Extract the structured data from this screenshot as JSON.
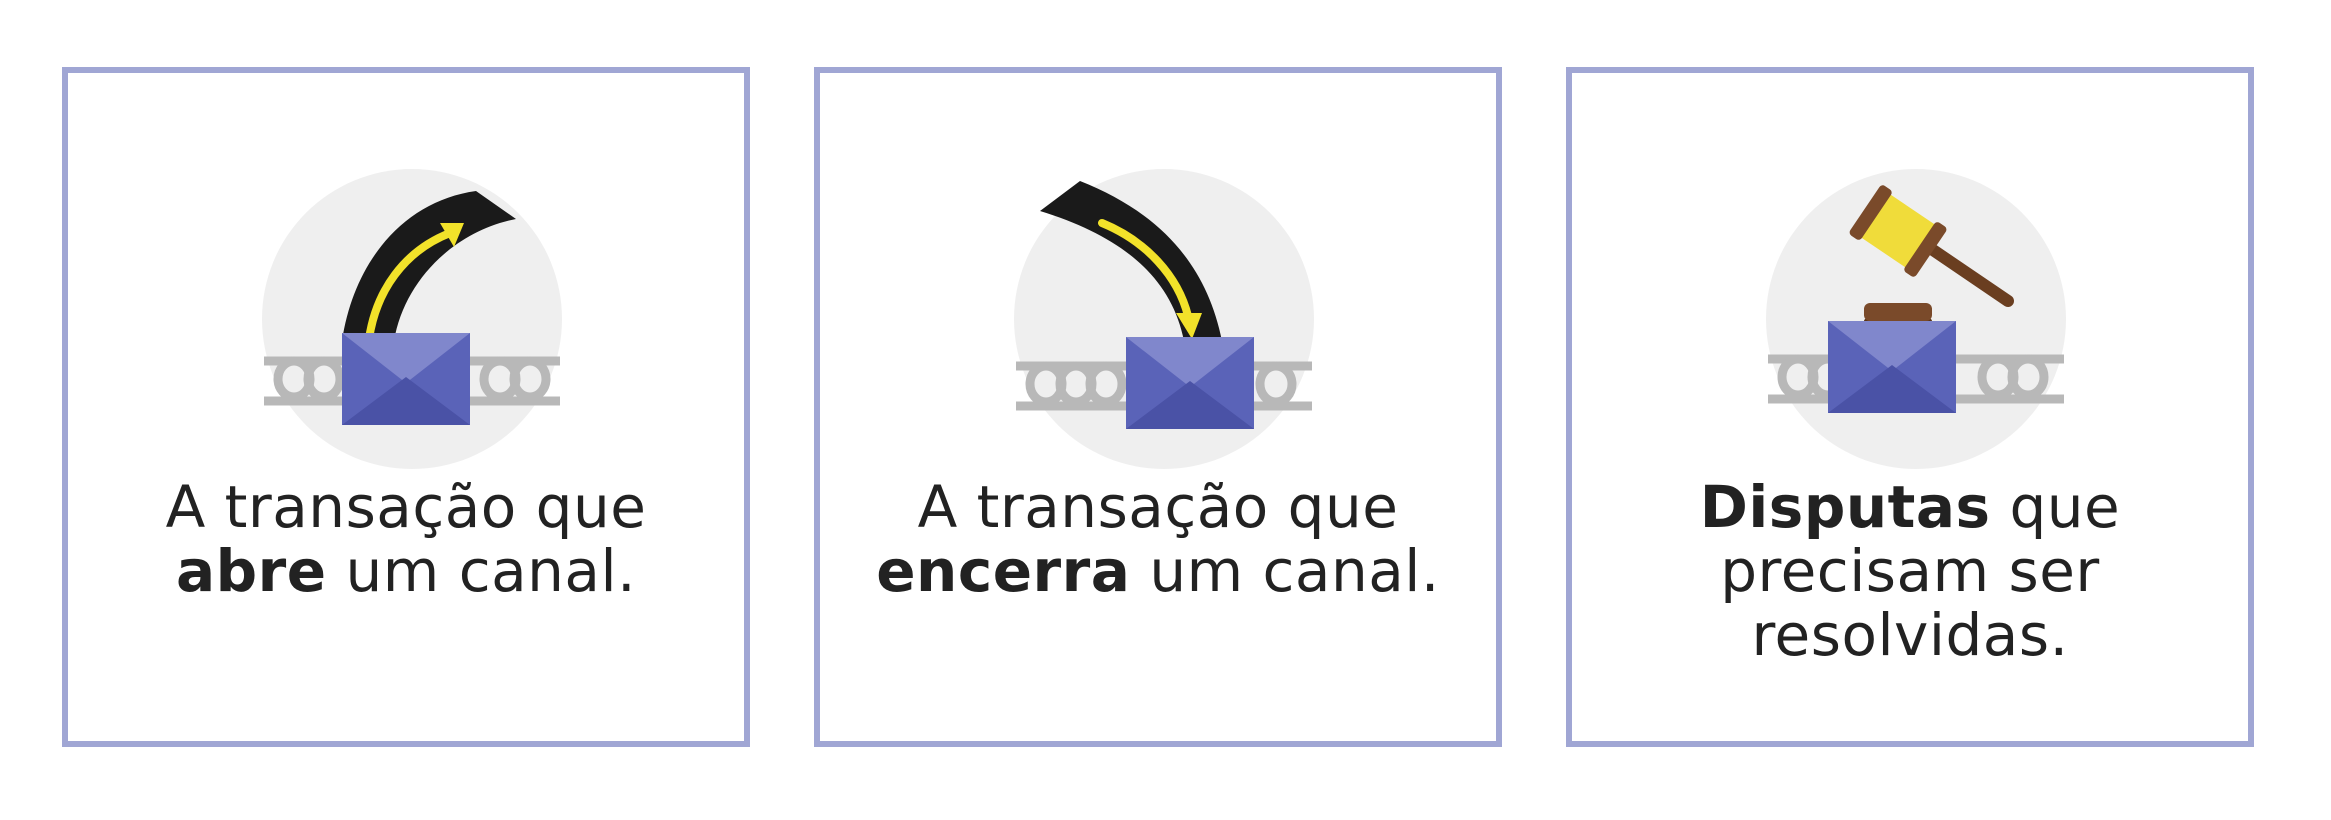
{
  "colors": {
    "border": "#a0a6d4",
    "envelope": "#5a63b8",
    "envelope_light": "#8087cc",
    "arrow_band": "#1a1a1a",
    "arrow": "#f2e22a",
    "chain": "#b8b8b8",
    "circle_bg": "#efefef",
    "gavel_wood": "#7a4a2a",
    "gavel_gold": "#f0dc3a",
    "text": "#222222"
  },
  "cards": [
    {
      "icon": "open-channel-icon",
      "line1": "A transação que",
      "line2_bold": "abre",
      "line2_rest": " um canal."
    },
    {
      "icon": "close-channel-icon",
      "line1": "A transação que",
      "line2_bold": "encerra",
      "line2_rest": " um canal."
    },
    {
      "icon": "gavel-dispute-icon",
      "line1_bold": "Disputas",
      "line1_rest": " que",
      "line2": "precisam ser",
      "line3": "resolvidas."
    }
  ]
}
